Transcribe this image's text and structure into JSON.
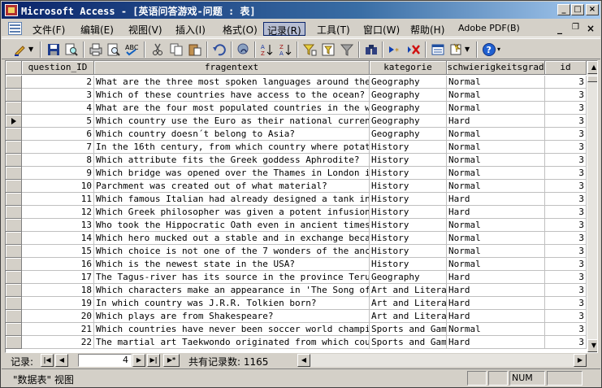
{
  "window": {
    "title": "Microsoft Access - [英语问答游戏-问题 : 表]",
    "minimize_label": "_",
    "maximize_label": "□",
    "close_label": "×"
  },
  "menu": {
    "items": [
      {
        "label": "文件(F)"
      },
      {
        "label": "编辑(E)"
      },
      {
        "label": "视图(V)"
      },
      {
        "label": "插入(I)"
      },
      {
        "label": "格式(O)"
      },
      {
        "label": "记录(R)"
      },
      {
        "label": "工具(T)"
      },
      {
        "label": "窗口(W)"
      },
      {
        "label": "帮助(H)"
      },
      {
        "label": "Adobe PDF(B)"
      }
    ],
    "active_item": "记录(R)",
    "doc_close_label": "×"
  },
  "table": {
    "columns": [
      {
        "label": "question_ID"
      },
      {
        "label": "fragentext"
      },
      {
        "label": "kategorie"
      },
      {
        "label": "schwierigkeitsgrad"
      },
      {
        "label": "id"
      }
    ],
    "current_record_row": 3,
    "rows": [
      {
        "question_id": "2",
        "fragentext": "What are the three most spoken languages around the worl",
        "kategorie": "Geography",
        "schwierigkeitsgrad": "Normal",
        "id": "3"
      },
      {
        "question_id": "3",
        "fragentext": "Which of these countries have access to the ocean?",
        "kategorie": "Geography",
        "schwierigkeitsgrad": "Normal",
        "id": "3"
      },
      {
        "question_id": "4",
        "fragentext": "What are the four most populated countries in the world?",
        "kategorie": "Geography",
        "schwierigkeitsgrad": "Normal",
        "id": "3"
      },
      {
        "question_id": "5",
        "fragentext": "Which country use the Euro as their national currency?",
        "kategorie": "Geography",
        "schwierigkeitsgrad": "Hard",
        "id": "3"
      },
      {
        "question_id": "6",
        "fragentext": "Which country doesn´t belong to Asia?",
        "kategorie": "Geography",
        "schwierigkeitsgrad": "Normal",
        "id": "3"
      },
      {
        "question_id": "7",
        "fragentext": "In the 16th century, from which country where potatoes i",
        "kategorie": "History",
        "schwierigkeitsgrad": "Normal",
        "id": "3"
      },
      {
        "question_id": "8",
        "fragentext": "Which attribute fits the Greek goddess Aphrodite?",
        "kategorie": "History",
        "schwierigkeitsgrad": "Normal",
        "id": "3"
      },
      {
        "question_id": "9",
        "fragentext": "Which bridge was opened over the Thames in London in 189",
        "kategorie": "History",
        "schwierigkeitsgrad": "Normal",
        "id": "3"
      },
      {
        "question_id": "10",
        "fragentext": "Parchment was created out of what material?",
        "kategorie": "History",
        "schwierigkeitsgrad": "Normal",
        "id": "3"
      },
      {
        "question_id": "11",
        "fragentext": "Which famous Italian had already designed a tank in the",
        "kategorie": "History",
        "schwierigkeitsgrad": "Hard",
        "id": "3"
      },
      {
        "question_id": "12",
        "fragentext": "Which Greek philosopher was given a potent infusion of t",
        "kategorie": "History",
        "schwierigkeitsgrad": "Hard",
        "id": "3"
      },
      {
        "question_id": "13",
        "fragentext": "Who took the Hippocratic Oath even in ancient times?",
        "kategorie": "History",
        "schwierigkeitsgrad": "Normal",
        "id": "3"
      },
      {
        "question_id": "14",
        "fragentext": "Which hero mucked out a stable and in exchange became a",
        "kategorie": "History",
        "schwierigkeitsgrad": "Normal",
        "id": "3"
      },
      {
        "question_id": "15",
        "fragentext": "Which choice is not one of the 7 wonders of the ancient",
        "kategorie": "History",
        "schwierigkeitsgrad": "Normal",
        "id": "3"
      },
      {
        "question_id": "16",
        "fragentext": "Which is the newest state in the USA?",
        "kategorie": "History",
        "schwierigkeitsgrad": "Normal",
        "id": "3"
      },
      {
        "question_id": "17",
        "fragentext": "The Tagus-river has its source in the province Teruel an",
        "kategorie": "Geography",
        "schwierigkeitsgrad": "Hard",
        "id": "3"
      },
      {
        "question_id": "18",
        "fragentext": "Which characters make an appearance in 'The Song of the",
        "kategorie": "Art and Literat",
        "schwierigkeitsgrad": "Hard",
        "id": "3"
      },
      {
        "question_id": "19",
        "fragentext": "In which country was J.R.R. Tolkien born?",
        "kategorie": "Art and Literat",
        "schwierigkeitsgrad": "Hard",
        "id": "3"
      },
      {
        "question_id": "20",
        "fragentext": "Which plays are from Shakespeare?",
        "kategorie": "Art and Literat",
        "schwierigkeitsgrad": "Hard",
        "id": "3"
      },
      {
        "question_id": "21",
        "fragentext": "Which countries have never been soccer world champion?",
        "kategorie": "Sports and Game",
        "schwierigkeitsgrad": "Normal",
        "id": "3"
      },
      {
        "question_id": "22",
        "fragentext": "The martial art Taekwondo originated from which country?",
        "kategorie": "Sports and Game",
        "schwierigkeitsgrad": "Hard",
        "id": "3"
      }
    ]
  },
  "navigator": {
    "label": "记录:",
    "current_record": "4",
    "total_text": "共有记录数: 1165"
  },
  "status": {
    "view_text": "\"数据表\" 视图",
    "indicator": "NUM"
  }
}
